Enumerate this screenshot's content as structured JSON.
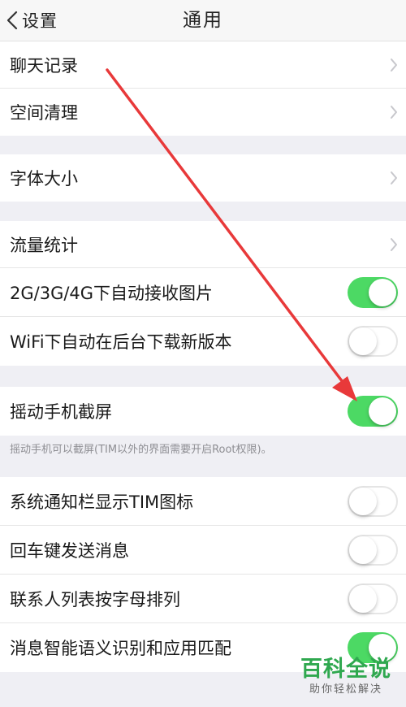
{
  "nav": {
    "back_label": "设置",
    "title": "通用"
  },
  "groups": [
    {
      "items": [
        {
          "label": "聊天记录",
          "accessory": "chevron"
        },
        {
          "label": "空间清理",
          "accessory": "chevron"
        }
      ]
    },
    {
      "items": [
        {
          "label": "字体大小",
          "accessory": "chevron"
        }
      ]
    },
    {
      "items": [
        {
          "label": "流量统计",
          "accessory": "chevron"
        },
        {
          "label": "2G/3G/4G下自动接收图片",
          "accessory": "switch",
          "on": true
        },
        {
          "label": "WiFi下自动在后台下载新版本",
          "accessory": "switch",
          "on": false
        }
      ]
    },
    {
      "items": [
        {
          "label": "摇动手机截屏",
          "accessory": "switch",
          "on": true
        }
      ],
      "footnote": "摇动手机可以截屏(TIM以外的界面需要开启Root权限)。"
    },
    {
      "items": [
        {
          "label": "系统通知栏显示TIM图标",
          "accessory": "switch",
          "on": false
        },
        {
          "label": "回车键发送消息",
          "accessory": "switch",
          "on": false
        },
        {
          "label": "联系人列表按字母排列",
          "accessory": "switch",
          "on": false
        },
        {
          "label": "消息智能语义识别和应用匹配",
          "accessory": "switch",
          "on": true
        }
      ]
    }
  ],
  "watermark": {
    "main": "百科全说",
    "sub": "助你轻松解决"
  },
  "colors": {
    "switch_on": "#4cd964",
    "arrow": "#e8393a",
    "watermark": "#2fa84f"
  }
}
